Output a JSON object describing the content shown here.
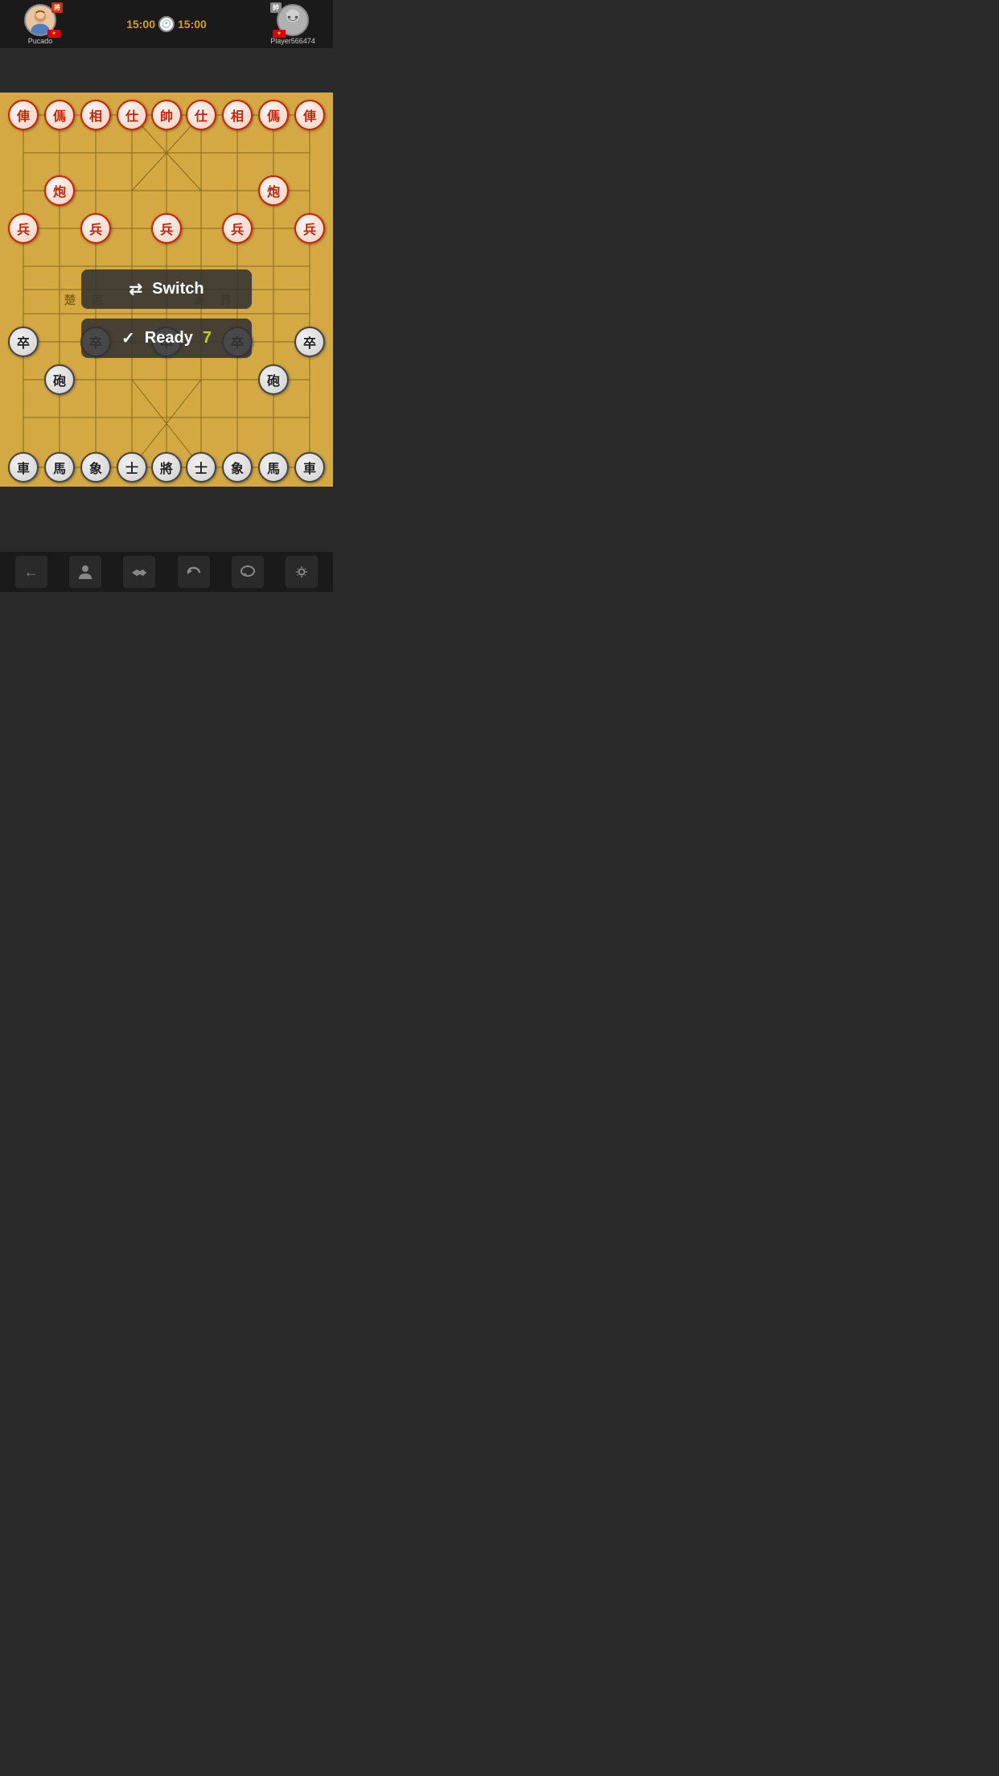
{
  "header": {
    "player1": {
      "name": "Pucado",
      "badge": "將",
      "avatar_char": "👩",
      "flag": "🇻🇳"
    },
    "player2": {
      "name": "Player566474",
      "badge": "帥",
      "avatar_char": "🐏",
      "flag": "🇻🇳"
    },
    "timer1": "15:00",
    "timer2": "15:00"
  },
  "buttons": {
    "switch_label": "Switch",
    "ready_label": "Ready",
    "ready_count": "7"
  },
  "toolbar": {
    "back": "←",
    "person": "🚶",
    "handshake": "🤝",
    "undo": "↩",
    "chat": "💬",
    "settings": "⚙"
  },
  "board": {
    "cols": 9,
    "rows": 10,
    "red_pieces": [
      {
        "char": "俥",
        "col": 0,
        "row": 0
      },
      {
        "char": "傌",
        "col": 1,
        "row": 0
      },
      {
        "char": "相",
        "col": 2,
        "row": 0
      },
      {
        "char": "仕",
        "col": 3,
        "row": 0
      },
      {
        "char": "帥",
        "col": 4,
        "row": 0
      },
      {
        "char": "仕",
        "col": 5,
        "row": 0
      },
      {
        "char": "相",
        "col": 6,
        "row": 0
      },
      {
        "char": "傌",
        "col": 7,
        "row": 0
      },
      {
        "char": "俥",
        "col": 8,
        "row": 0
      },
      {
        "char": "炮",
        "col": 1,
        "row": 2
      },
      {
        "char": "炮",
        "col": 7,
        "row": 2
      },
      {
        "char": "兵",
        "col": 0,
        "row": 3
      },
      {
        "char": "兵",
        "col": 2,
        "row": 3
      },
      {
        "char": "兵",
        "col": 4,
        "row": 3
      },
      {
        "char": "兵",
        "col": 6,
        "row": 3
      },
      {
        "char": "兵",
        "col": 8,
        "row": 3
      }
    ],
    "black_pieces": [
      {
        "char": "車",
        "col": 0,
        "row": 9
      },
      {
        "char": "馬",
        "col": 1,
        "row": 9
      },
      {
        "char": "象",
        "col": 2,
        "row": 9
      },
      {
        "char": "士",
        "col": 3,
        "row": 9
      },
      {
        "char": "將",
        "col": 4,
        "row": 9
      },
      {
        "char": "士",
        "col": 5,
        "row": 9
      },
      {
        "char": "象",
        "col": 6,
        "row": 9
      },
      {
        "char": "馬",
        "col": 7,
        "row": 9
      },
      {
        "char": "車",
        "col": 8,
        "row": 9
      },
      {
        "char": "砲",
        "col": 1,
        "row": 7
      },
      {
        "char": "砲",
        "col": 7,
        "row": 7
      },
      {
        "char": "卒",
        "col": 0,
        "row": 6
      },
      {
        "char": "卒",
        "col": 2,
        "row": 6
      },
      {
        "char": "卒",
        "col": 4,
        "row": 6
      },
      {
        "char": "卒",
        "col": 6,
        "row": 6
      },
      {
        "char": "卒",
        "col": 8,
        "row": 6
      }
    ]
  }
}
